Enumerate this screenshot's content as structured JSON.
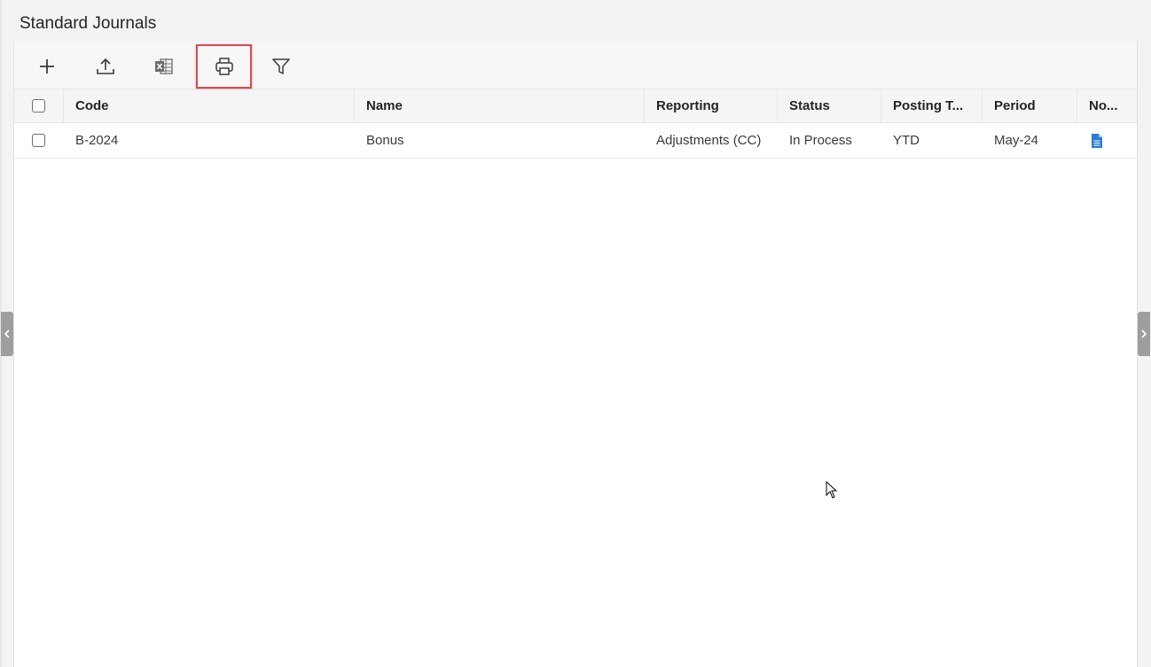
{
  "page": {
    "title": "Standard Journals"
  },
  "toolbar": {
    "buttons": [
      {
        "name": "add",
        "icon": "plus-icon"
      },
      {
        "name": "upload",
        "icon": "upload-icon"
      },
      {
        "name": "excel-export",
        "icon": "excel-icon"
      },
      {
        "name": "print",
        "icon": "printer-icon",
        "highlighted": true
      },
      {
        "name": "filter",
        "icon": "filter-icon"
      }
    ]
  },
  "grid": {
    "columns": [
      "Code",
      "Name",
      "Reporting",
      "Status",
      "Posting T...",
      "Period",
      "No..."
    ],
    "rows": [
      {
        "code": "B-2024",
        "name": "Bonus",
        "reporting": "Adjustments (CC)",
        "status": "In Process",
        "posting_type": "YTD",
        "period": "May-24",
        "notes_icon": "document-icon"
      }
    ]
  },
  "colors": {
    "highlight": "#e0494d",
    "doc_icon": "#2b7cd3",
    "handle": "#9e9e9e"
  }
}
